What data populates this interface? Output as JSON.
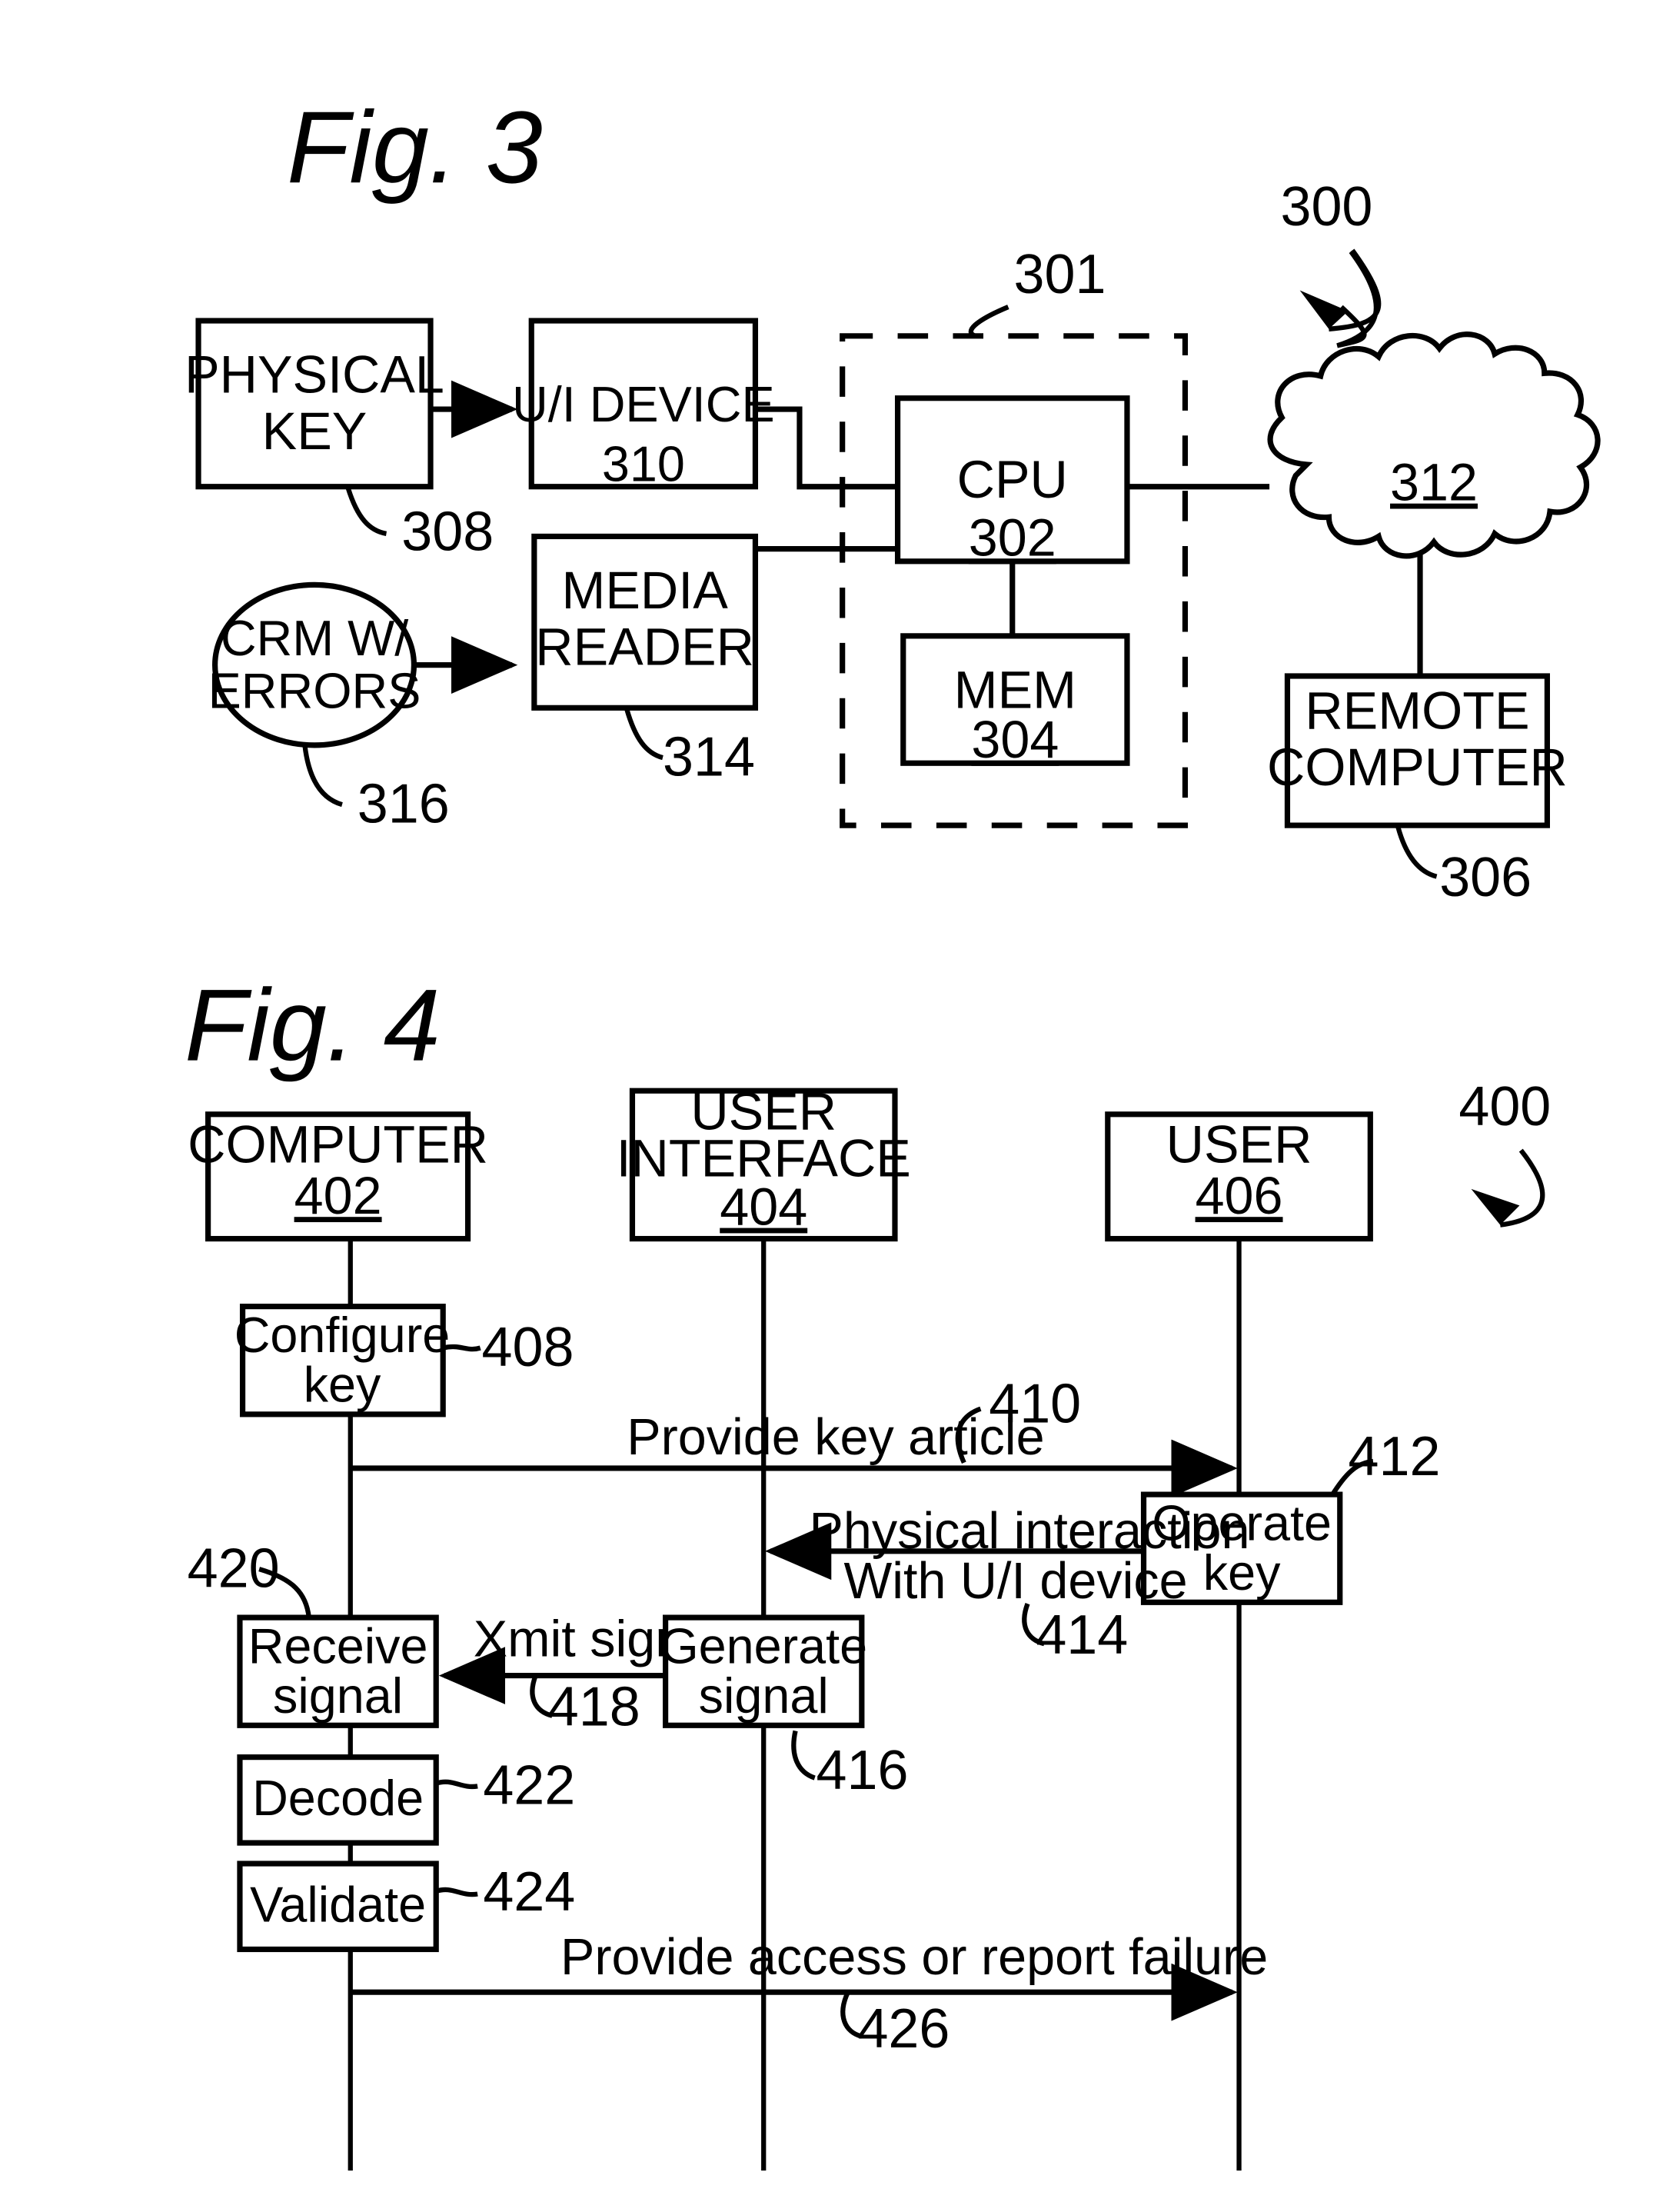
{
  "figures": [
    {
      "title": "Fig. 3",
      "system_ref": "300",
      "dashed_group_ref": "301",
      "nodes": {
        "physical_key": "PHYSICAL\nKEY",
        "physical_key_line1": "PHYSICAL",
        "physical_key_line2": "KEY",
        "physical_key_ref": "308",
        "ui_device_label": "U/I DEVICE",
        "ui_device_ref": "310",
        "crm_line1": "CRM W/",
        "crm_line2": "ERRORS",
        "crm_ref": "316",
        "media_reader_line1": "MEDIA",
        "media_reader_line2": "READER",
        "media_reader_ref": "314",
        "cpu_label": "CPU",
        "cpu_ref": "302",
        "mem_label": "MEM",
        "mem_ref": "304",
        "cloud_ref": "312",
        "remote_line1": "REMOTE",
        "remote_line2": "COMPUTER",
        "remote_ref": "306"
      }
    },
    {
      "title": "Fig. 4",
      "system_ref": "400",
      "lanes": [
        {
          "label_line1": "COMPUTER",
          "label_line2": "",
          "ref": "402"
        },
        {
          "label_line1": "USER",
          "label_line2": "INTERFACE",
          "ref": "404"
        },
        {
          "label_line1": "USER",
          "label_line2": "",
          "ref": "406"
        }
      ],
      "activations": [
        {
          "line1": "Configure",
          "line2": "key",
          "ref": "408"
        },
        {
          "line1": "Operate",
          "line2": "key",
          "ref": "412"
        },
        {
          "line1": "Receive",
          "line2": "signal",
          "ref": "420"
        },
        {
          "line1": "Generate",
          "line2": "signal",
          "ref": "416"
        },
        {
          "line1": "Decode",
          "line2": "",
          "ref": "422"
        },
        {
          "line1": "Validate",
          "line2": "",
          "ref": "424"
        }
      ],
      "messages": [
        {
          "text": "Provide key article",
          "ref": "410"
        },
        {
          "text_line1": "Physical interaction",
          "text_line2": "With U/I device",
          "ref": "414"
        },
        {
          "text": "Xmit signal",
          "ref": "418"
        },
        {
          "text": "Provide access or report failure",
          "ref": "426"
        }
      ]
    }
  ],
  "fig3": {
    "title": "Fig. 3",
    "ref_300": "300",
    "ref_301": "301",
    "ref_308": "308",
    "ref_310": "310",
    "ref_314": "314",
    "ref_316": "316",
    "ref_302": "302",
    "ref_304": "304",
    "ref_306": "306",
    "ref_312": "312",
    "physical_key_1": "PHYSICAL",
    "physical_key_2": "KEY",
    "ui_device": "U/I DEVICE",
    "crm_1": "CRM W/",
    "crm_2": "ERRORS",
    "media_1": "MEDIA",
    "media_2": "READER",
    "cpu": "CPU",
    "mem": "MEM",
    "remote_1": "REMOTE",
    "remote_2": "COMPUTER"
  },
  "fig4": {
    "title": "Fig. 4",
    "ref_400": "400",
    "lane1_1": "COMPUTER",
    "lane1_ref": "402",
    "lane2_1": "USER",
    "lane2_2": "INTERFACE",
    "lane2_ref": "404",
    "lane3_1": "USER",
    "lane3_ref": "406",
    "configure_1": "Configure",
    "configure_2": "key",
    "ref_408": "408",
    "provide_key_article": "Provide key article",
    "ref_410": "410",
    "operate_1": "Operate",
    "operate_2": "key",
    "ref_412": "412",
    "physical_int_1": "Physical interaction",
    "physical_int_2": "With U/I device",
    "ref_414": "414",
    "receive_1": "Receive",
    "receive_2": "signal",
    "ref_420": "420",
    "xmit": "Xmit signal",
    "ref_418": "418",
    "generate_1": "Generate",
    "generate_2": "signal",
    "ref_416": "416",
    "decode": "Decode",
    "ref_422": "422",
    "validate": "Validate",
    "ref_424": "424",
    "provide_access": "Provide access or report failure",
    "ref_426": "426"
  }
}
